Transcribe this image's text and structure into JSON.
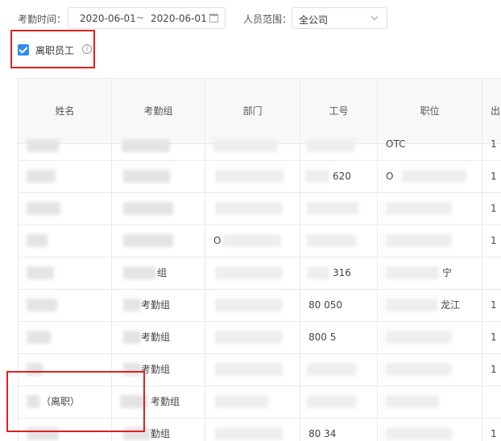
{
  "filters": {
    "time_label": "考勤时间：",
    "date_start": "2020-06-01",
    "date_sep": "~",
    "date_end": "2020-06-01",
    "scope_label": "人员范围：",
    "scope_value": "全公司"
  },
  "resigned_filter": {
    "label": "离职员工",
    "checked": true,
    "info_icon": "info-icon"
  },
  "table": {
    "columns": [
      "姓名",
      "考勤组",
      "部门",
      "工号",
      "职位",
      "出"
    ],
    "rows": [
      {
        "name": "",
        "group": "",
        "dept": "",
        "id": "",
        "position": "OTC",
        "last": "1"
      },
      {
        "name": "",
        "group": "",
        "dept": "",
        "id": "620",
        "position": "O",
        "last": "1"
      },
      {
        "name": "",
        "group": "",
        "dept": "",
        "id": "",
        "position": "",
        "last": "1"
      },
      {
        "name": "",
        "group": "",
        "dept": "O",
        "id": "",
        "position": "",
        "last": "1"
      },
      {
        "name": "",
        "group": "组",
        "dept": "",
        "id": "316",
        "position": "宁",
        "last": ""
      },
      {
        "name": "",
        "group": "考勤组",
        "dept": "",
        "id": "80 050",
        "position": "龙江",
        "last": "1"
      },
      {
        "name": "",
        "group": "考勤组",
        "dept": "",
        "id": "800 5",
        "position": "",
        "last": "1"
      },
      {
        "name": "",
        "group": "考勤组",
        "dept": "",
        "id": "",
        "position": "",
        "last": "1"
      },
      {
        "name": "（离职）",
        "group": "考勤组",
        "dept": "",
        "id": "",
        "position": "",
        "last": ""
      },
      {
        "name": "",
        "group": "勤组",
        "dept": "",
        "id": "80 34",
        "position": "",
        "last": "1"
      }
    ]
  },
  "colors": {
    "accent": "#2d8cf0",
    "annotation": "#e02020"
  }
}
